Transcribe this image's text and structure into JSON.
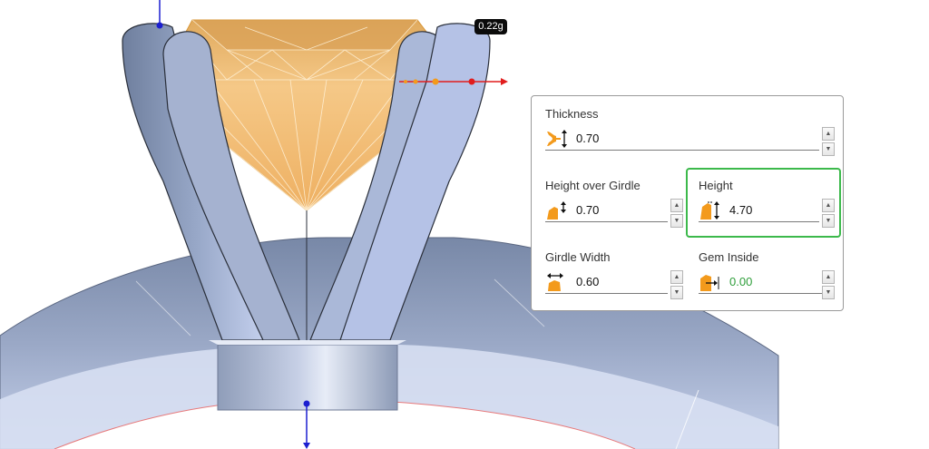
{
  "viewport": {
    "weight_badge": "0.22g",
    "colors": {
      "metal": "#8b9bb8",
      "metal_light": "#b6c4e6",
      "gem": "#f1b96a",
      "gem_edge": "#e8a546",
      "axis_red": "#e11d1d",
      "axis_blue": "#1c1fd0",
      "handle_orange": "#f39a1c"
    }
  },
  "panel": {
    "thickness": {
      "label": "Thickness",
      "value": "0.70",
      "icon": "thickness-icon"
    },
    "height_over_girdle": {
      "label": "Height over Girdle",
      "value": "0.70",
      "icon": "height-over-girdle-icon"
    },
    "height": {
      "label": "Height",
      "value": "4.70",
      "icon": "height-icon"
    },
    "girdle_width": {
      "label": "Girdle Width",
      "value": "0.60",
      "icon": "girdle-width-icon"
    },
    "gem_inside": {
      "label": "Gem Inside",
      "value": "0.00",
      "icon": "gem-inside-icon"
    },
    "spin_up": "▲",
    "spin_down": "▼",
    "highlight_color": "#3cb94b"
  }
}
